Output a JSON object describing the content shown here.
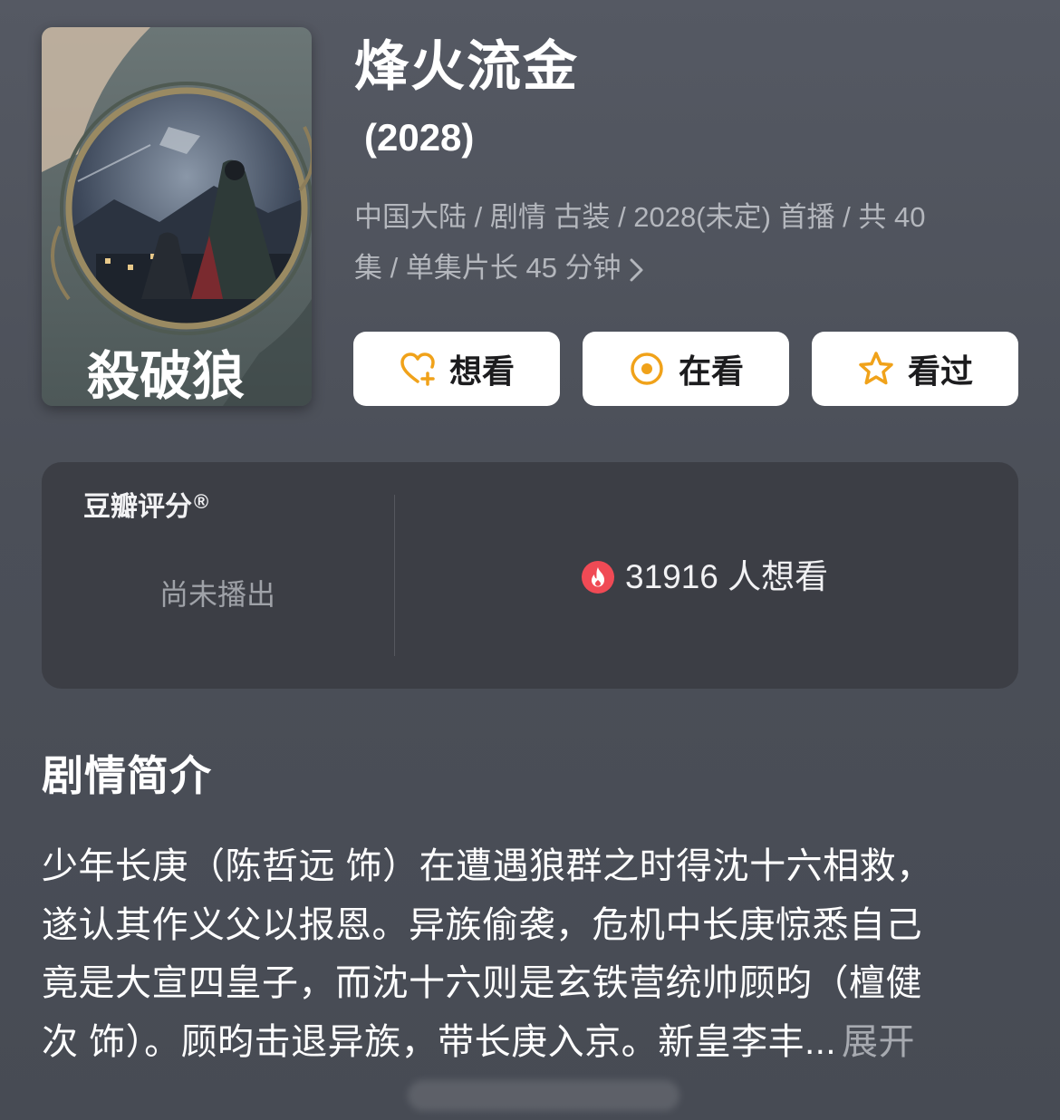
{
  "poster": {
    "calligraphy": "殺破狼"
  },
  "header": {
    "title": "烽火流金",
    "year": "(2028)",
    "meta_line1": "中国大陆 / 剧情 古装 / 2028(未定) 首播 / 共 40",
    "meta_line2": "集 / 单集片长 45 分钟"
  },
  "actions": {
    "want_label": "想看",
    "watching_label": "在看",
    "watched_label": "看过"
  },
  "rating": {
    "title": "豆瓣评分",
    "registered_mark": "®",
    "status": "尚未播出",
    "want_count": "31916 人想看"
  },
  "synopsis": {
    "heading": "剧情简介",
    "lines": [
      "少年长庚（陈哲远 饰）在遭遇狼群之时得沈十六相救，",
      "遂认其作义父以报恩。异族偷袭，危机中长庚惊悉自己",
      "竟是大宣四皇子，而沈十六则是玄铁营统帅顾昀（檀健",
      "次 饰）。顾昀击退异族，带长庚入京。新皇李丰..."
    ],
    "expand_label": "展开"
  },
  "colors": {
    "background": "#4b4f58",
    "card": "#3c3e45",
    "button_bg": "#ffffff",
    "icon_accent": "#f0a21a",
    "fire_red": "#f04a55",
    "muted_text": "#b4b7bd"
  }
}
